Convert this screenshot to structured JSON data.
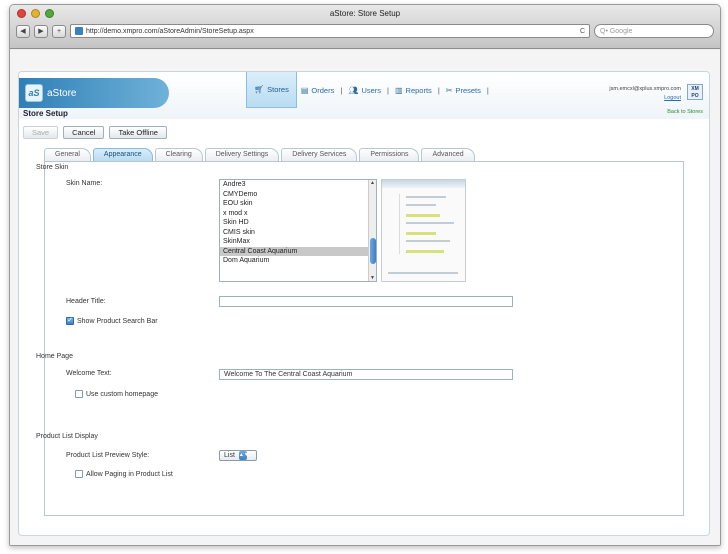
{
  "browser": {
    "window_title": "aStore: Store Setup",
    "url": "http://demo.xmpro.com/aStoreAdmin/StoreSetup.aspx",
    "search_placeholder": "Q• Google",
    "reload_symbol": "C"
  },
  "app": {
    "logo_text": "aStore",
    "logo_mark": "aS",
    "page_title": "Store Setup",
    "back_link": "Back to Stores",
    "nav": [
      {
        "label": "Stores",
        "icon": "cart-icon"
      },
      {
        "label": "Orders",
        "icon": "orders-icon"
      },
      {
        "label": "Users",
        "icon": "users-icon"
      },
      {
        "label": "Reports",
        "icon": "reports-icon"
      },
      {
        "label": "Presets",
        "icon": "presets-icon"
      }
    ],
    "nav_separator": "|",
    "user_email": "jsm.emcxl@xplus.xmpro.com",
    "logout": "Logout",
    "user_logo_text": "XM PO"
  },
  "toolbar": {
    "save_label": "Save",
    "cancel_label": "Cancel",
    "offline_label": "Take Offline"
  },
  "tabs": [
    "General",
    "Appearance",
    "Clearing",
    "Delivery Settings",
    "Delivery Services",
    "Permissions",
    "Advanced"
  ],
  "appearance": {
    "store_skin_section": "Store Skin",
    "skin_name_label": "Skin Name:",
    "skins": [
      "Andre3",
      "CMYDemo",
      "EOU skin",
      "x mod x",
      "Skin HD",
      "CMIS skin",
      "SkinMax",
      "Central Coast Aquarium",
      "Dom Aquarium"
    ],
    "selected_skin": "Central Coast Aquarium",
    "header_title_label": "Header Title:",
    "header_title_value": "",
    "show_search_label": "Show Product Search Bar",
    "show_search_checked": true,
    "home_page_section": "Home Page",
    "welcome_label": "Welcome Text:",
    "welcome_value": "Welcome To The Central Coast Aquarium",
    "custom_home_label": "Use custom homepage",
    "custom_home_checked": false,
    "product_list_section": "Product List Display",
    "preview_style_label": "Product List Preview Style:",
    "preview_style_value": "List",
    "paging_label": "Allow Paging in Product List",
    "paging_checked": false
  }
}
